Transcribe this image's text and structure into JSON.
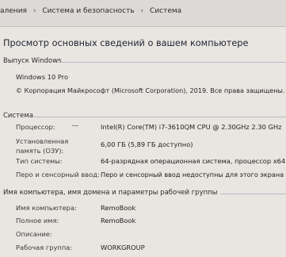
{
  "breadcrumb": {
    "items": [
      "аления",
      "Система и безопасность",
      "Система"
    ]
  },
  "page_title": "Просмотр основных сведений о вашем компьютере",
  "windows_edition": {
    "heading": "Выпуск Windows",
    "edition": "Windows 10 Pro",
    "copyright": "© Корпорация Майкрософт (Microsoft Corporation), 2019. Все права защищены."
  },
  "system": {
    "heading": "Система",
    "rows": [
      {
        "label": "Процессор:",
        "value": "Intel(R) Core(TM) i7-3610QM CPU @ 2.30GHz   2.30 GHz"
      },
      {
        "label": "Установленная память (ОЗУ):",
        "value": "6,00 ГБ (5,89 ГБ доступно)"
      },
      {
        "label": "Тип системы:",
        "value": "64-разрядная операционная система, процессор x64"
      },
      {
        "label": "Перо и сенсорный ввод:",
        "value": "Перо и сенсорный ввод недоступны для этого экрана"
      }
    ]
  },
  "computer_name": {
    "heading": "Имя компьютера, имя домена и параметры рабочей группы",
    "rows": [
      {
        "label": "Имя компьютера:",
        "value": "RemoBook"
      },
      {
        "label": "Полное имя:",
        "value": "RemoBook"
      },
      {
        "label": "Описание:",
        "value": ""
      },
      {
        "label": "Рабочая группа:",
        "value": "WORKGROUP"
      }
    ]
  },
  "colors": {
    "background": "#e9e6e2",
    "title_text": "#1f2430",
    "section_line": "#b8b8c2"
  }
}
